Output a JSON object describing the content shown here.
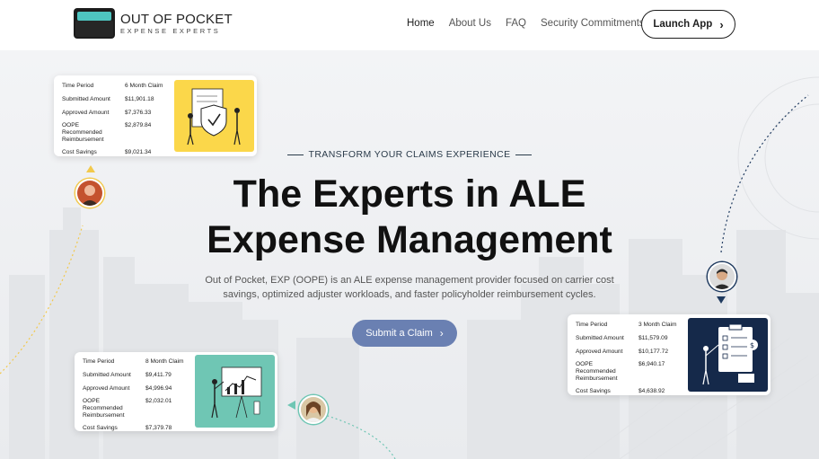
{
  "brand": {
    "title": "OUT OF POCKET",
    "subtitle": "EXPENSE EXPERTS"
  },
  "nav": {
    "items": [
      "Home",
      "About Us",
      "FAQ",
      "Security Commitments"
    ],
    "launch_label": "Launch App"
  },
  "hero": {
    "eyebrow": "TRANSFORM YOUR CLAIMS EXPERIENCE",
    "headline_line1": "The Experts in ALE",
    "headline_line2": "Expense Management",
    "subcopy": "Out of Pocket, EXP (OOPE) is an ALE expense management provider focused on carrier cost savings, optimized adjuster workloads, and faster policyholder reimbursement cycles.",
    "cta_label": "Submit a Claim"
  },
  "cards": [
    {
      "rows": [
        {
          "k": "Time Period",
          "v": "6 Month Claim"
        },
        {
          "k": "Submitted Amount",
          "v": "$11,901.18"
        },
        {
          "k": "Approved Amount",
          "v": "$7,376.33"
        },
        {
          "k": "OOPE Recommended Reimbursement",
          "v": "$2,879.84"
        },
        {
          "k": "Cost Savings",
          "v": "$9,021.34"
        }
      ]
    },
    {
      "rows": [
        {
          "k": "Time Period",
          "v": "8 Month Claim"
        },
        {
          "k": "Submitted Amount",
          "v": "$9,411.79"
        },
        {
          "k": "Approved Amount",
          "v": "$4,996.94"
        },
        {
          "k": "OOPE Recommended Reimbursement",
          "v": "$2,032.01"
        },
        {
          "k": "Cost Savings",
          "v": "$7,379.78"
        }
      ]
    },
    {
      "rows": [
        {
          "k": "Time Period",
          "v": "3 Month Claim"
        },
        {
          "k": "Submitted Amount",
          "v": "$11,579.09"
        },
        {
          "k": "Approved Amount",
          "v": "$10,177.72"
        },
        {
          "k": "OOPE Recommended Reimbursement",
          "v": "$6,940.17"
        },
        {
          "k": "Cost Savings",
          "v": "$4,638.92"
        }
      ]
    }
  ],
  "colors": {
    "cta": "#6a80b2",
    "card1_illustration": "#fbd74a",
    "card2_illustration": "#6fc6b4",
    "card3_illustration": "#15294a",
    "path_yellow": "#f2c94c",
    "path_teal": "#6fc6b4",
    "path_navy": "#1f3a5f"
  },
  "icons": [
    "chevron-right-icon",
    "shield-check-icon",
    "whiteboard-icon",
    "clipboard-icon"
  ]
}
